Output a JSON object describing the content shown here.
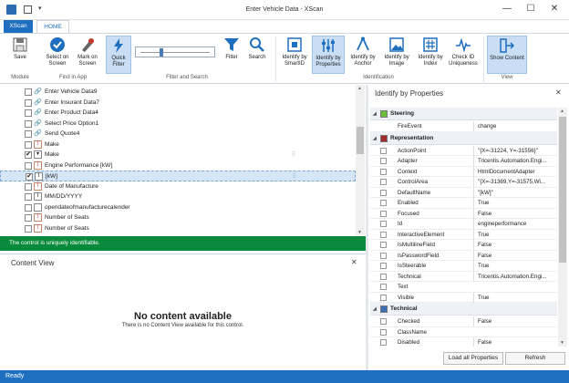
{
  "window": {
    "title": "Enter Vehicle Data - XScan",
    "minimize": "—",
    "maximize": "☐",
    "close": "✕"
  },
  "ribbon_tabs": {
    "file": "XScan",
    "home": "HOME"
  },
  "ribbon": {
    "save": "Save",
    "select_on_screen": "Select on Screen",
    "mark_on_screen": "Mark on Screen",
    "quick_filter": "Quick Filter",
    "filter": "Filter",
    "search": "Search",
    "identify_by_smartid": "Identify by SmartID",
    "identify_by_properties": "Identify by Properties",
    "identify_by_anchor": "Identify by Anchor",
    "identify_by_image": "Identify by Image",
    "identify_by_index": "Identify by Index",
    "check_id_uniqueness": "Check ID Uniqueness",
    "show_content": "Show Content",
    "groups": {
      "module": "Module",
      "find_in_app": "Find in App",
      "filter_and_search": "Filter and Search",
      "identification": "Identification",
      "view": "View"
    }
  },
  "tree": {
    "rows": [
      {
        "label": "Enter Vehicle Data9",
        "icon": "link-icon",
        "checked": false
      },
      {
        "label": "Enter Insurant Data7",
        "icon": "link-icon",
        "checked": false
      },
      {
        "label": "Enter Product Data4",
        "icon": "link-icon",
        "checked": false
      },
      {
        "label": "Select Price Option1",
        "icon": "link-icon",
        "checked": false
      },
      {
        "label": "Send Quote4",
        "icon": "link-icon",
        "checked": false
      },
      {
        "label": "Make",
        "icon": "text-icon",
        "checked": false
      },
      {
        "label": "Make",
        "icon": "combo-icon",
        "checked": true,
        "marked": true
      },
      {
        "label": "Engine Performance [kW]",
        "icon": "text-icon",
        "checked": false
      },
      {
        "label": "[kW]",
        "icon": "textbox-icon",
        "checked": true,
        "marked": true,
        "selected": true
      },
      {
        "label": "Date of Manufacture",
        "icon": "text-icon",
        "checked": false
      },
      {
        "label": "MM/DD/YYYY",
        "icon": "textbox-icon",
        "checked": false
      },
      {
        "label": "opendateofmanufacturecalender",
        "icon": "box-icon",
        "checked": false
      },
      {
        "label": "Number of Seats",
        "icon": "text-icon",
        "checked": false
      },
      {
        "label": "Number of Seats",
        "icon": "text-icon",
        "checked": false
      }
    ]
  },
  "uniqueness_status": "The control is uniquely identifiable.",
  "content_view": {
    "title": "Content View",
    "no_content_title": "No content available",
    "no_content_text": "There is no Content View available for this control."
  },
  "identify_panel": {
    "title": "Identify by Properties",
    "categories": [
      {
        "name": "Steering",
        "color": "#6cbf3c",
        "props": [
          {
            "name": "FireEvent",
            "value": "change",
            "checkbox": false
          }
        ]
      },
      {
        "name": "Representation",
        "color": "#a02b2b",
        "props": [
          {
            "name": "ActionPoint",
            "value": "\"{X=-31224, Y=-31556}\""
          },
          {
            "name": "Adapter",
            "value": "Tricentis.Automation.Engi..."
          },
          {
            "name": "Context",
            "value": "HtmlDocumentAdapter"
          },
          {
            "name": "ControlArea",
            "value": "\"{X=-31369,Y=-31575,Wi..."
          },
          {
            "name": "DefaultName",
            "value": "\"[kW]\""
          },
          {
            "name": "Enabled",
            "value": "True"
          },
          {
            "name": "Focused",
            "value": "False"
          },
          {
            "name": "Id",
            "value": "engineperformance"
          },
          {
            "name": "InteractiveElement",
            "value": "True"
          },
          {
            "name": "IsMultilineField",
            "value": "False"
          },
          {
            "name": "IsPasswordField",
            "value": "False"
          },
          {
            "name": "IsSteerable",
            "value": "True"
          },
          {
            "name": "Technical",
            "value": "Tricentis.Automation.Engi..."
          },
          {
            "name": "Text",
            "value": ""
          },
          {
            "name": "Visible",
            "value": "True"
          }
        ]
      },
      {
        "name": "Technical",
        "color": "#3a6fb3",
        "props": [
          {
            "name": "Checked",
            "value": "False"
          },
          {
            "name": "ClassName",
            "value": ""
          },
          {
            "name": "Disabled",
            "value": "False"
          }
        ]
      }
    ],
    "load_all": "Load all Properties",
    "refresh": "Refresh"
  },
  "statusbar": "Ready"
}
